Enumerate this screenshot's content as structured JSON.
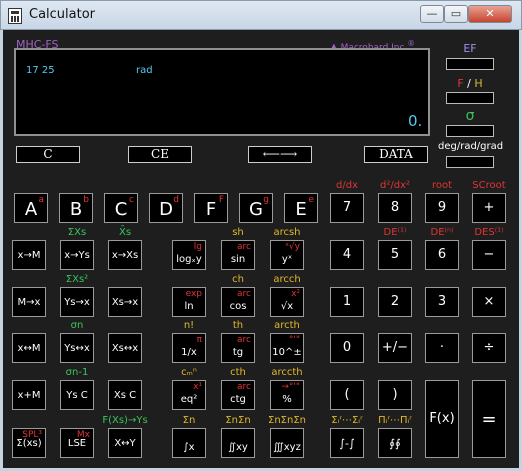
{
  "window": {
    "title": "Calculator",
    "min": "—",
    "max": "▭",
    "close": "✕"
  },
  "display": {
    "model": "MHC-FS",
    "brand": "Macrohard Inc.",
    "brand_mark": "®",
    "line_left": "17 25",
    "line_right": "rad",
    "value": "0."
  },
  "side": {
    "ef": "EF",
    "f": "F",
    "slash": " / ",
    "h": "H",
    "sigma": "σ",
    "mode": "deg/rad/grad"
  },
  "fbuttons": {
    "c": "C",
    "ce": "CE",
    "arrows": "⟵⟶",
    "data": "DATA"
  },
  "hex": [
    {
      "main": "A",
      "sup": "a"
    },
    {
      "main": "B",
      "sup": "b"
    },
    {
      "main": "C",
      "sup": "c"
    },
    {
      "main": "D",
      "sup": "d"
    },
    {
      "main": "F",
      "sup": "F"
    },
    {
      "main": "G",
      "sup": "g"
    },
    {
      "main": "E",
      "sup": "e"
    }
  ],
  "colors": {
    "bg": "#1e1e1e",
    "display": "#000000",
    "cyan": "#57c8f2",
    "purple": "#9f62c8",
    "red": "#e03535",
    "green": "#3cc35a",
    "yellow": "#e0b82b"
  },
  "stats": [
    {
      "main": "x→M"
    },
    {
      "main": "x→Ys",
      "cap": "ΣXs"
    },
    {
      "main": "x→Xs",
      "cap": "X̄s"
    },
    {
      "main": "M→x"
    },
    {
      "main": "Ys→x",
      "cap": "ΣXs²"
    },
    {
      "main": "Xs→x"
    },
    {
      "main": "x↔M"
    },
    {
      "main": "Ys↔x",
      "cap": "σn"
    },
    {
      "main": "Xs↔x"
    },
    {
      "main": "x+M"
    },
    {
      "main": "Ys C",
      "cap": "σn-1"
    },
    {
      "main": "Xs C"
    },
    {
      "main": "Σ(xs)",
      "sup": "SPL³"
    },
    {
      "main": "LSE",
      "sup": "Mx"
    },
    {
      "main": "X↔Y",
      "cap": "F(Xs)→Ys"
    }
  ],
  "func": [
    {
      "main": "logₓy",
      "sup": "lg"
    },
    {
      "main": "sin",
      "sup": "arc",
      "cap": "sh"
    },
    {
      "main": "yˣ",
      "sup": "ˣ√y",
      "cap": "arcsh"
    },
    {
      "main": "ln",
      "sup": "exp"
    },
    {
      "main": "cos",
      "sup": "arc",
      "cap": "ch"
    },
    {
      "main": "√x",
      "sup": "x²",
      "cap": "arcch"
    },
    {
      "main": "1/x",
      "sup": "π",
      "cap": "n!"
    },
    {
      "main": "tg",
      "sup": "arc",
      "cap": "th"
    },
    {
      "main": "10^±",
      "sup": "°'\"",
      "cap": "arcth"
    },
    {
      "main": "eq²",
      "sup": "x¹",
      "cap": "cₘⁿ"
    },
    {
      "main": "ctg",
      "sup": "arc",
      "cap": "cth"
    },
    {
      "main": "%",
      "sup": "→°'\"",
      "cap": "arccth"
    },
    {
      "main": "∫x",
      "cap": "Σn"
    },
    {
      "main": "∬xy",
      "cap": "ΣnΣn"
    },
    {
      "main": "∭xyz",
      "cap": "ΣnΣnΣn"
    }
  ],
  "nums": [
    {
      "main": "7",
      "cap": "d/dx"
    },
    {
      "main": "8",
      "cap": "d²/dx²"
    },
    {
      "main": "9",
      "cap": "root"
    },
    {
      "main": "+",
      "cap": "SCroot"
    },
    {
      "main": "4"
    },
    {
      "main": "5",
      "cap": "DE⁽¹⁾"
    },
    {
      "main": "6",
      "cap": "DE⁽ⁿ⁾"
    },
    {
      "main": "−",
      "cap": "DES⁽¹⁾"
    },
    {
      "main": "1"
    },
    {
      "main": "2"
    },
    {
      "main": "3"
    },
    {
      "main": "×"
    },
    {
      "main": "0"
    },
    {
      "main": "+/−"
    },
    {
      "main": "·"
    },
    {
      "main": "÷"
    },
    {
      "main": "("
    },
    {
      "main": ")"
    },
    {
      "main": "F(x)"
    },
    {
      "main": "="
    },
    {
      "main": "∫-∫",
      "cap": "Σᵢʳ⋯Σᵢʳ"
    },
    {
      "main": "∮∮",
      "cap": "Πᵢʳ⋯Πᵢʳ"
    }
  ]
}
